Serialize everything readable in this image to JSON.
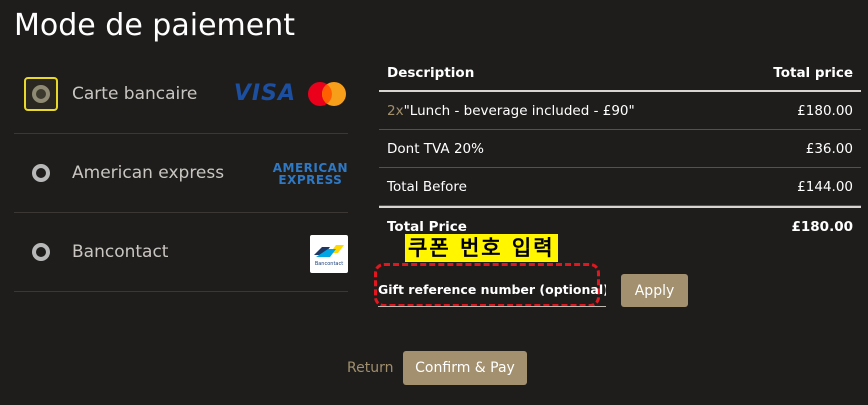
{
  "page": {
    "title": "Mode de paiement"
  },
  "payment_methods": [
    {
      "label": "Carte bancaire",
      "selected": true,
      "logos": [
        "visa-logo",
        "mastercard-logo"
      ],
      "visa_text": "VISA"
    },
    {
      "label": "American express",
      "selected": false,
      "logos": [
        "amex-logo"
      ],
      "amex_line1": "AMERICAN",
      "amex_line2": "EXPRESS"
    },
    {
      "label": "Bancontact",
      "selected": false,
      "logos": [
        "bancontact-logo"
      ],
      "bc_text": "Bancontact"
    }
  ],
  "table": {
    "headers": {
      "description": "Description",
      "total": "Total price"
    },
    "rows": [
      {
        "qty": "2x",
        "description": "\"Lunch - beverage included - £90\"",
        "total": "£180.00"
      },
      {
        "qty": "",
        "description": "Dont TVA 20%",
        "total": "£36.00"
      },
      {
        "qty": "",
        "description": "Total Before",
        "total": "£144.00"
      }
    ],
    "total_row": {
      "label": "Total Price",
      "value": "£180.00"
    }
  },
  "annotation": {
    "text": "쿠폰 번호 입력",
    "bg": "#fff600",
    "border": "#e2161e"
  },
  "gift": {
    "placeholder": "Gift reference number (optional)",
    "apply_label": "Apply"
  },
  "footer": {
    "return_label": "Return",
    "confirm_label": "Confirm & Pay"
  },
  "colors": {
    "accent": "#a3906f",
    "background": "#1f1d1c",
    "selected_border": "#e8d82a"
  }
}
